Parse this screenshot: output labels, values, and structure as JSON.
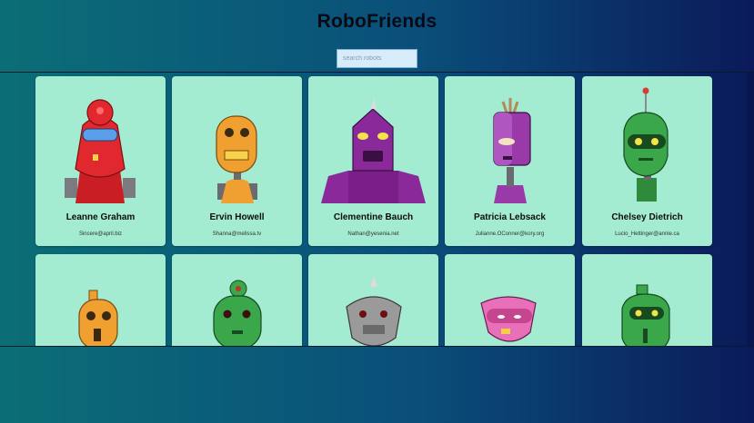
{
  "app": {
    "title": "RoboFriends"
  },
  "search": {
    "placeholder": "search robots",
    "value": ""
  },
  "robots": [
    {
      "name": "Leanne Graham",
      "email": "Sincere@april.biz",
      "color": "#d92a2a",
      "icon": "red-robot"
    },
    {
      "name": "Ervin Howell",
      "email": "Shanna@melissa.tv",
      "color": "#f0a030",
      "icon": "orange-robot"
    },
    {
      "name": "Clementine Bauch",
      "email": "Nathan@yesenia.net",
      "color": "#8a2a9a",
      "icon": "purple-robot"
    },
    {
      "name": "Patricia Lebsack",
      "email": "Julianne.OConner@kory.org",
      "color": "#9a3aa8",
      "icon": "purple-robot"
    },
    {
      "name": "Chelsey Dietrich",
      "email": "Lucio_Hettinger@annie.ca",
      "color": "#3aa84a",
      "icon": "green-robot"
    },
    {
      "name": "",
      "email": "",
      "color": "#f0a030",
      "icon": "orange-robot"
    },
    {
      "name": "",
      "email": "",
      "color": "#3aa84a",
      "icon": "green-robot"
    },
    {
      "name": "",
      "email": "",
      "color": "#9a9a9a",
      "icon": "gray-robot"
    },
    {
      "name": "",
      "email": "",
      "color": "#e870b8",
      "icon": "pink-robot"
    },
    {
      "name": "",
      "email": "",
      "color": "#3aa84a",
      "icon": "green-robot"
    }
  ]
}
